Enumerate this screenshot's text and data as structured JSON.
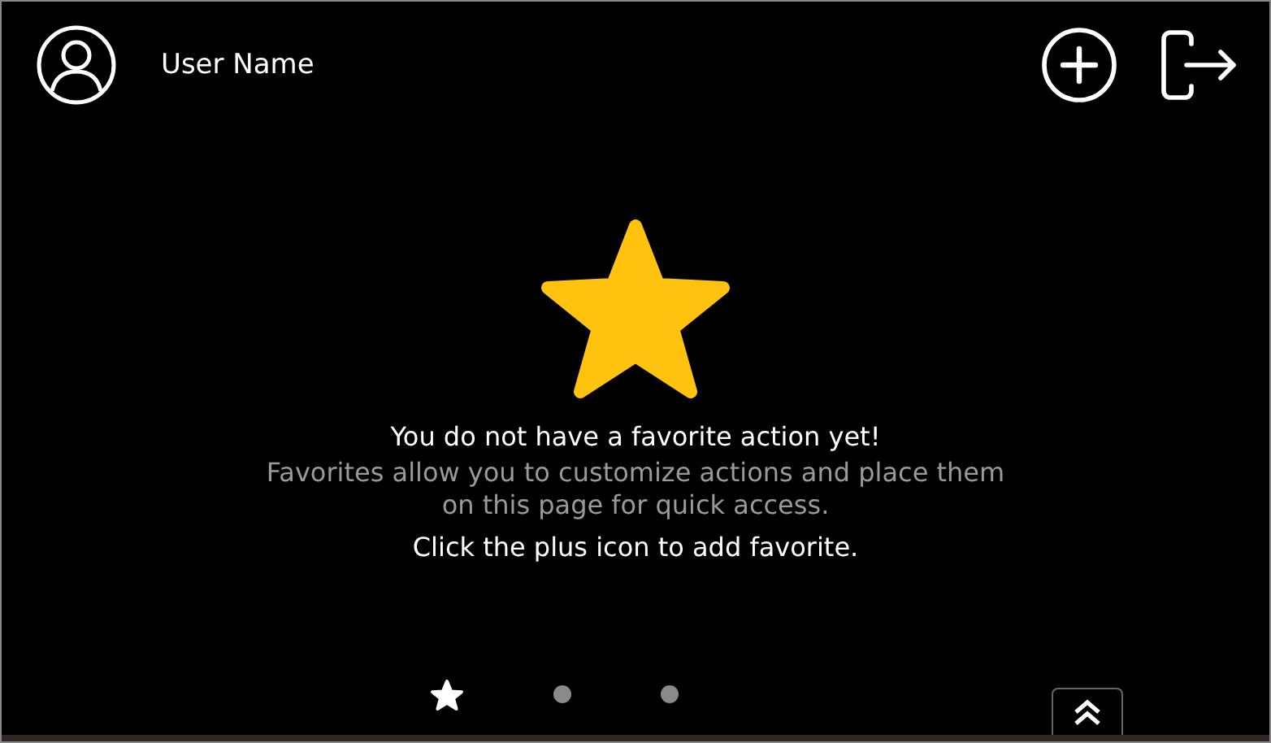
{
  "header": {
    "user_name": "User Name"
  },
  "empty_state": {
    "title": "You do not have a favorite action yet!",
    "description": "Favorites allow you to customize actions and place them on this page for quick access.",
    "hint": "Click the plus icon to add favorite."
  },
  "pages": [
    {
      "kind": "favorites",
      "selected": true
    },
    {
      "kind": "dot",
      "selected": false
    },
    {
      "kind": "dot",
      "selected": false
    }
  ]
}
